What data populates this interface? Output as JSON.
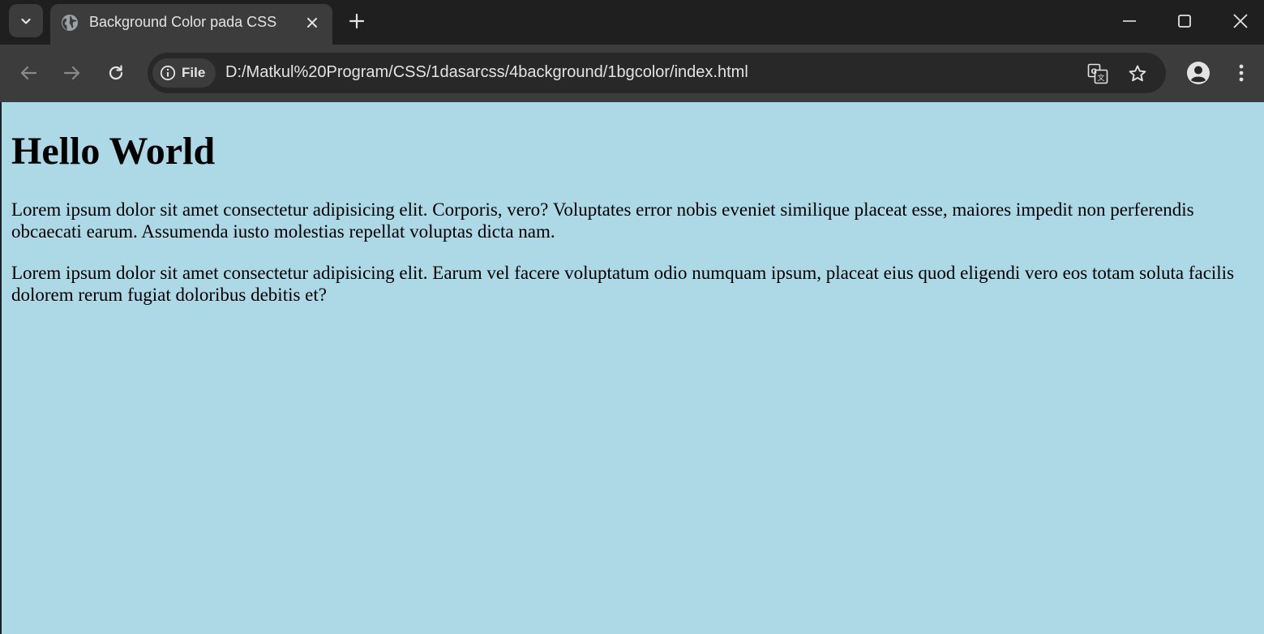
{
  "browser": {
    "tab": {
      "title": "Background Color pada CSS",
      "favicon": "globe-icon"
    },
    "address_bar": {
      "chip_label": "File",
      "url": "D:/Matkul%20Program/CSS/1dasarcss/4background/1bgcolor/index.html"
    },
    "icons": [
      "chevron-down-icon",
      "close-icon",
      "plus-icon",
      "minimize-icon",
      "maximize-icon",
      "back-arrow-icon",
      "forward-arrow-icon",
      "reload-icon",
      "info-icon",
      "translate-icon",
      "star-icon",
      "profile-icon",
      "kebab-menu-icon"
    ]
  },
  "page": {
    "background_color": "#add8e6",
    "heading": "Hello World",
    "paragraphs": [
      "Lorem ipsum dolor sit amet consectetur adipisicing elit. Corporis, vero? Voluptates error nobis eveniet similique placeat esse, maiores impedit non perferendis obcaecati earum. Assumenda iusto molestias repellat voluptas dicta nam.",
      "Lorem ipsum dolor sit amet consectetur adipisicing elit. Earum vel facere voluptatum odio numquam ipsum, placeat eius quod eligendi vero eos totam soluta facilis dolorem rerum fugiat doloribus debitis et?"
    ]
  }
}
